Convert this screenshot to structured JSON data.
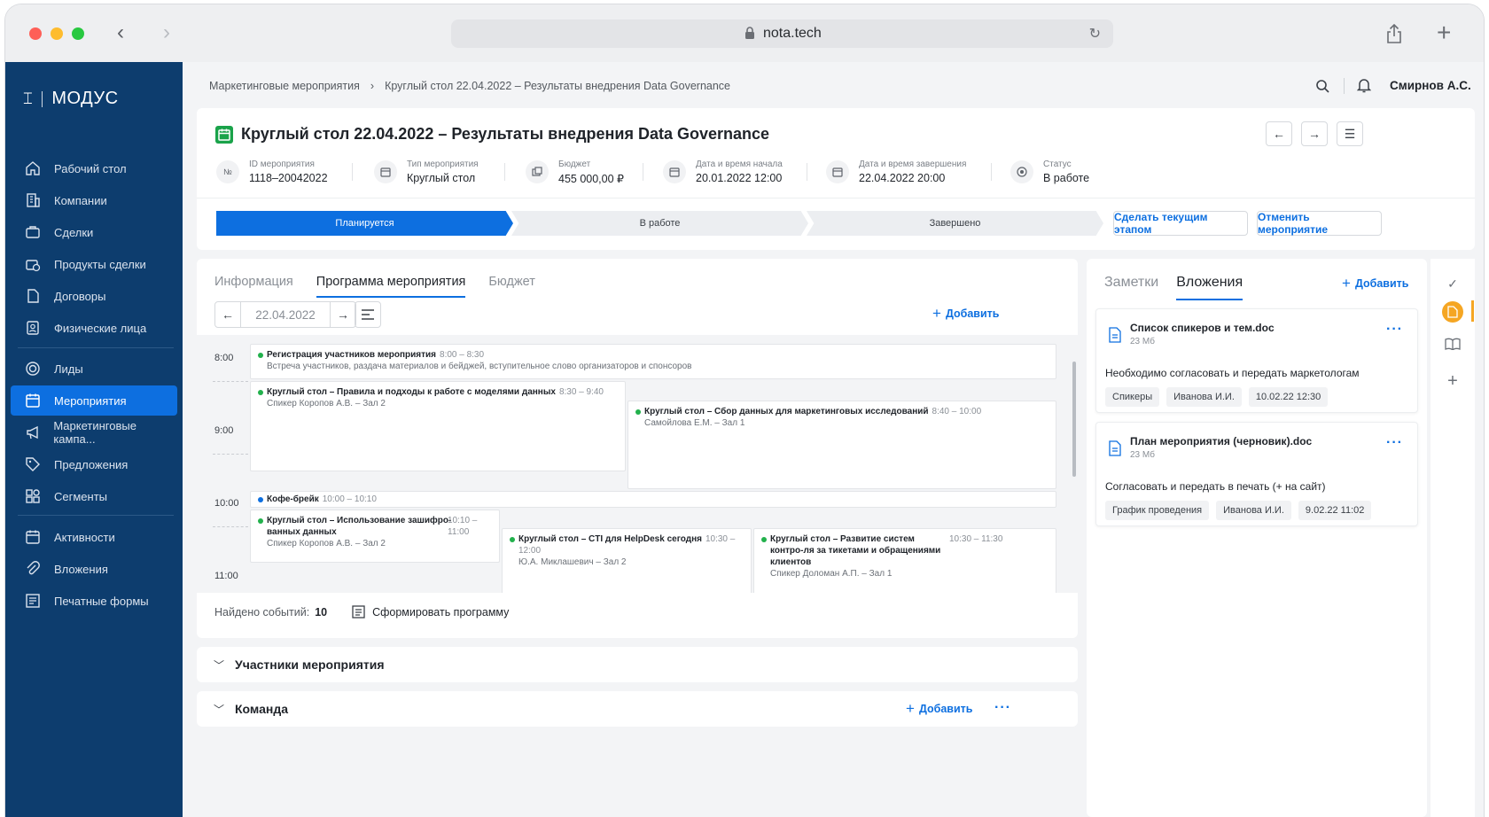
{
  "browser": {
    "url": "nota.tech"
  },
  "sidebar": {
    "logo": "МОДУС",
    "items": [
      {
        "label": "Рабочий стол",
        "icon": "home-icon"
      },
      {
        "label": "Компании",
        "icon": "building-icon"
      },
      {
        "label": "Сделки",
        "icon": "briefcase-icon"
      },
      {
        "label": "Продукты сделки",
        "icon": "product-icon"
      },
      {
        "label": "Договоры",
        "icon": "document-icon"
      },
      {
        "label": "Физические лица",
        "icon": "person-card-icon"
      },
      {
        "label": "Лиды",
        "icon": "target-icon"
      },
      {
        "label": "Мероприятия",
        "icon": "calendar-icon"
      },
      {
        "label": "Маркетинговые кампа...",
        "icon": "megaphone-icon"
      },
      {
        "label": "Предложения",
        "icon": "tag-icon"
      },
      {
        "label": "Сегменты",
        "icon": "segments-icon"
      },
      {
        "label": "Активности",
        "icon": "activity-icon"
      },
      {
        "label": "Вложения",
        "icon": "paperclip-icon"
      },
      {
        "label": "Печатные формы",
        "icon": "print-form-icon"
      }
    ]
  },
  "header": {
    "breadcrumb": [
      "Маркетинговые мероприятия",
      "Круглый стол 22.04.2022 – Результаты внедрения Data Governance"
    ],
    "user": "Смирнов А.С."
  },
  "event": {
    "title": "Круглый стол 22.04.2022 – Результаты внедрения Data Governance",
    "meta": [
      {
        "label": "ID мероприятия",
        "value": "1118–20042022",
        "icon": "№"
      },
      {
        "label": "Тип мероприятия",
        "value": "Круглый стол",
        "icon": "calendar-icon"
      },
      {
        "label": "Бюджет",
        "value": "455 000,00 ₽",
        "icon": "money-icon"
      },
      {
        "label": "Дата и время начала",
        "value": "20.01.2022 12:00",
        "icon": "calendar-icon"
      },
      {
        "label": "Дата и время завершения",
        "value": "22.04.2022 20:00",
        "icon": "calendar-icon"
      },
      {
        "label": "Статус",
        "value": "В работе",
        "icon": "status-icon"
      }
    ],
    "stages": [
      "Планируется",
      "В работе",
      "Завершено"
    ],
    "current_stage": "Планируется",
    "make_current_label": "Сделать текущим этапом",
    "cancel_label": "Отменить мероприятие"
  },
  "program": {
    "tabs": [
      "Информация",
      "Программа мероприятия",
      "Бюджет"
    ],
    "active_tab": "Программа мероприятия",
    "date": "22.04.2022",
    "add_label": "Добавить",
    "hours": [
      "8:00",
      "9:00",
      "10:00",
      "11:00"
    ],
    "events": [
      {
        "title": "Регистрация участников мероприятия",
        "time": "8:00 – 8:30",
        "desc": "Встреча участников, раздача материалов и бейджей, вступительное слово организаторов и спонсоров"
      },
      {
        "title": "Круглый стол – Правила и подходы к работе с моделями данных",
        "time": "8:30 – 9:40",
        "desc": "Спикер Коропов А.В. – Зал 2"
      },
      {
        "title": "Круглый стол – Сбор данных для маркетинговых исследований",
        "time": "8:40 – 10:00",
        "desc": "Самойлова Е.М. – Зал 1"
      },
      {
        "title": "Кофе-брейк",
        "time": "10:00 – 10:10",
        "desc": ""
      },
      {
        "title": "Круглый стол – Использование зашифро-ванных данных",
        "time": "10:10 – 11:00",
        "desc": "Спикер Коропов А.В. – Зал 2"
      },
      {
        "title": "Круглый стол – CTI для HelpDesk сегодня",
        "time": "10:30 – 12:00",
        "desc": "Ю.А. Миклашевич – Зал 2"
      },
      {
        "title": "Круглый стол – Развитие систем контро-ля за тикетами и обращениями клиентов",
        "time": "10:30 – 11:30",
        "desc": "Спикер Доломан А.П. – Зал 1"
      }
    ],
    "found_label": "Найдено событий:",
    "found_count": "10",
    "generate_label": "Сформировать программу"
  },
  "participants": {
    "title": "Участники мероприятия"
  },
  "team": {
    "title": "Команда",
    "add_label": "Добавить"
  },
  "right_panel": {
    "tabs": [
      "Заметки",
      "Вложения"
    ],
    "active_tab": "Вложения",
    "add_label": "Добавить",
    "attachments": [
      {
        "name": "Список спикеров и тем.doc",
        "size": "23 Мб",
        "desc": "Необходимо согласовать и передать маркетологам",
        "tags": [
          "Спикеры",
          "Иванова И.И.",
          "10.02.22 12:30"
        ]
      },
      {
        "name": "План мероприятия (черновик).doc",
        "size": "23 Мб",
        "desc": "Согласовать и передать в печать (+ на сайт)",
        "tags": [
          "График проведения",
          "Иванова И.И.",
          "9.02.22 11:02"
        ]
      }
    ]
  },
  "colors": {
    "sidebar_bg": "#0d3d6e",
    "accent": "#0d6fe0",
    "event_dot": "#22b14c",
    "attachment_active": "#f5a623"
  }
}
